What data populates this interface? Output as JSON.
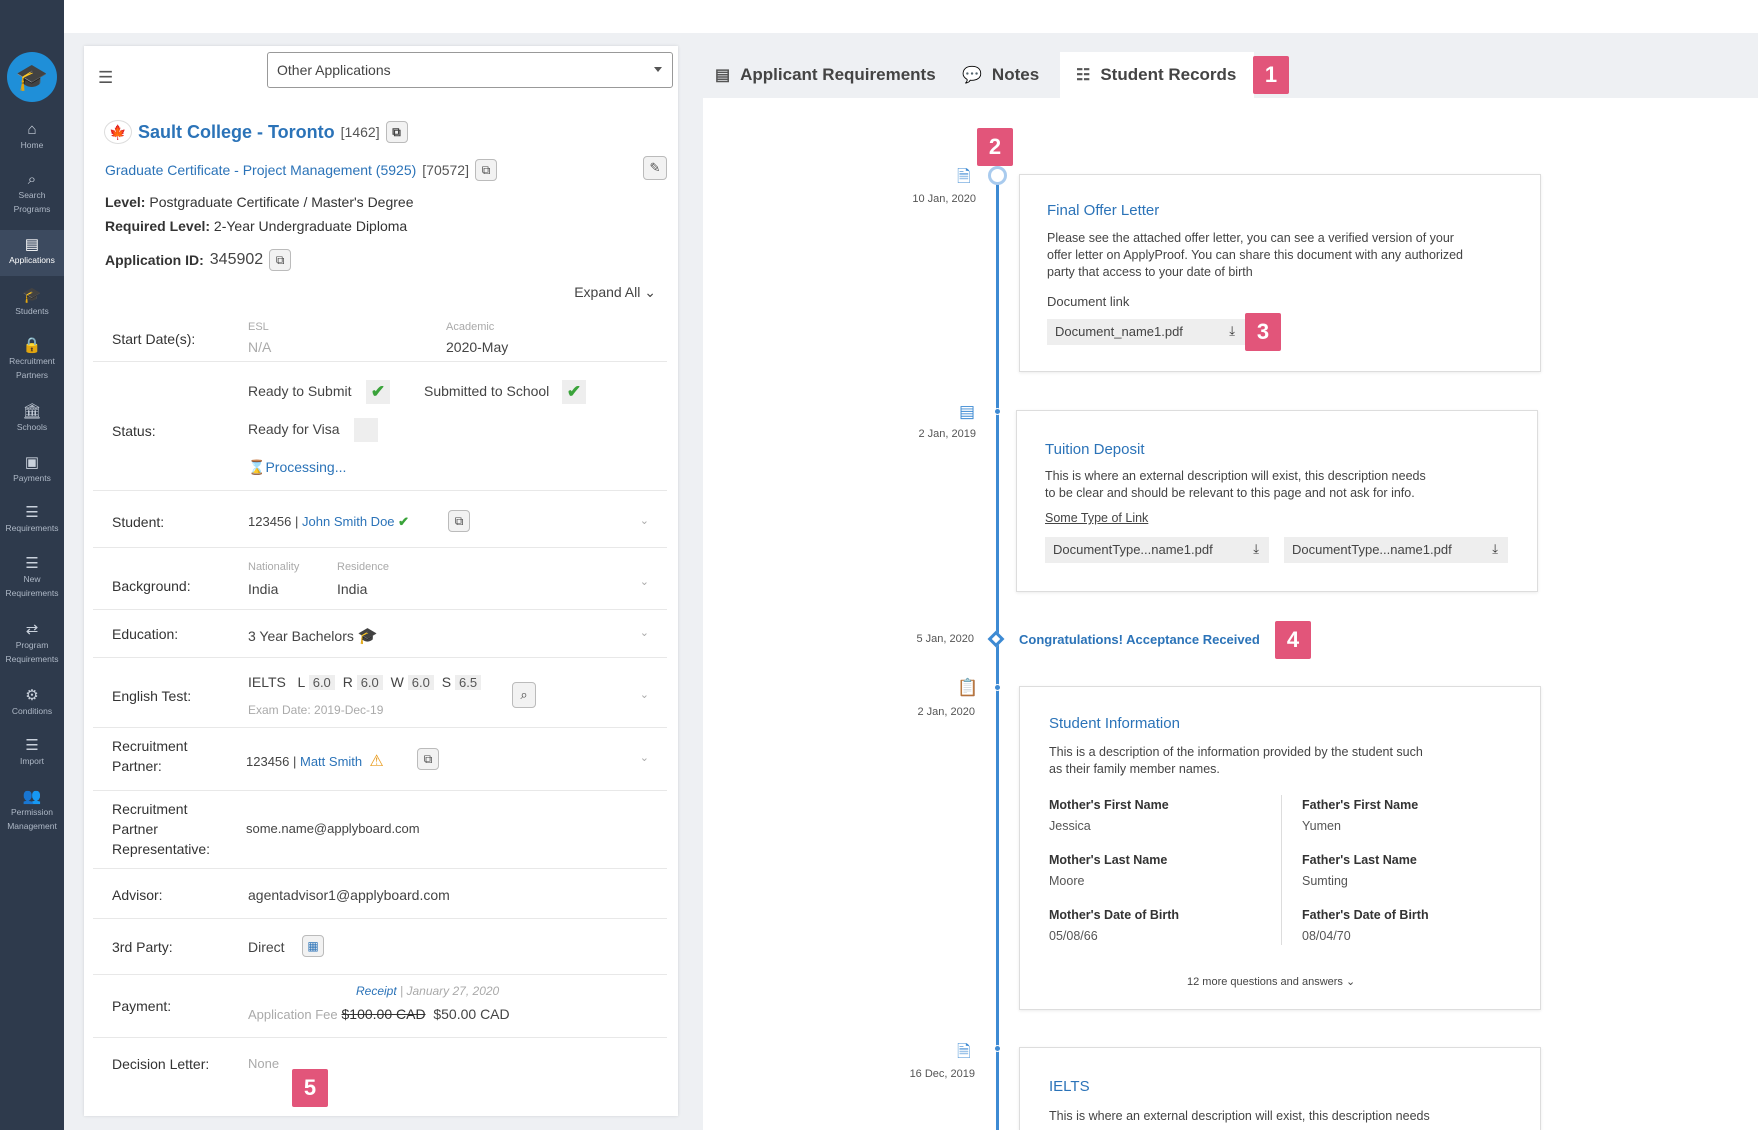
{
  "sidebar": {
    "items": [
      {
        "icon": "home-icon",
        "label": "Home"
      },
      {
        "icon": "search-icon",
        "label": "Search Programs"
      },
      {
        "icon": "applications-icon",
        "label": "Applications"
      },
      {
        "icon": "students-icon",
        "label": "Students"
      },
      {
        "icon": "lock-icon",
        "label": "Recruitment Partners"
      },
      {
        "icon": "schools-icon",
        "label": "Schools"
      },
      {
        "icon": "payments-icon",
        "label": "Payments"
      },
      {
        "icon": "list-icon",
        "label": "Requirements"
      },
      {
        "icon": "list-icon",
        "label": "New Requirements"
      },
      {
        "icon": "swap-icon",
        "label": "Program Requirements"
      },
      {
        "icon": "gears-icon",
        "label": "Conditions"
      },
      {
        "icon": "list-icon",
        "label": "Import"
      },
      {
        "icon": "users-icon",
        "label": "Permission Management"
      }
    ]
  },
  "application": {
    "select_value": "Other Applications",
    "school": "Sault College - Toronto",
    "school_id": "[1462]",
    "program": "Graduate Certificate - Project Management (5925)",
    "program_id": "[70572]",
    "level_label": "Level:",
    "level": "Postgraduate Certificate / Master's Degree",
    "required_level_label": "Required Level:",
    "required_level": "2-Year Undergraduate Diploma",
    "app_id_label": "Application ID:",
    "app_id": "345902",
    "expand_all": "Expand All"
  },
  "details": {
    "start_dates": {
      "label": "Start Date(s):",
      "esl_label": "ESL",
      "esl": "N/A",
      "academic_label": "Academic",
      "academic": "2020-May"
    },
    "status": {
      "label": "Status:",
      "ready_submit": "Ready to Submit",
      "submitted": "Submitted to School",
      "ready_visa": "Ready for Visa",
      "processing": "Processing..."
    },
    "student": {
      "label": "Student:",
      "id": "123456",
      "sep": "|",
      "name": "John Smith Doe"
    },
    "background": {
      "label": "Background:",
      "nationality_label": "Nationality",
      "nationality": "India",
      "residence_label": "Residence",
      "residence": "India"
    },
    "education": {
      "label": "Education:",
      "value": "3 Year Bachelors"
    },
    "english": {
      "label": "English Test:",
      "test": "IELTS",
      "l": "L",
      "l_val": "6.0",
      "r": "R",
      "r_val": "6.0",
      "w": "W",
      "w_val": "6.0",
      "s": "S",
      "s_val": "6.5",
      "exam_date": "Exam Date: 2019-Dec-19"
    },
    "partner": {
      "label_1": "Recruitment",
      "label_2": "Partner:",
      "id": "123456 |",
      "name": "Matt Smith"
    },
    "partner_rep": {
      "label_1": "Recruitment",
      "label_2": "Partner",
      "label_3": "Representative:",
      "value": "some.name@applyboard.com"
    },
    "advisor": {
      "label": "Advisor:",
      "value": "agentadvisor1@applyboard.com"
    },
    "third_party": {
      "label": "3rd Party:",
      "value": "Direct"
    },
    "payment": {
      "label": "Payment:",
      "receipt": "Receipt",
      "receipt_date": "| January 27, 2020",
      "fee_label": "Application Fee",
      "old_fee": "$100.00 CAD",
      "new_fee": "$50.00 CAD"
    },
    "decision": {
      "label": "Decision Letter:",
      "value": "None"
    }
  },
  "tabs": [
    {
      "label": "Applicant Requirements",
      "icon": "document-icon"
    },
    {
      "label": "Notes",
      "icon": "chat-icon"
    },
    {
      "label": "Student Records",
      "icon": "records-icon"
    }
  ],
  "badges": [
    "1",
    "2",
    "3",
    "4",
    "5"
  ],
  "timeline": {
    "offer": {
      "date": "10 Jan, 2020",
      "title": "Final Offer Letter",
      "desc_1": "Please see the attached offer letter, you can see a verified version of your",
      "desc_2": "offer letter on ApplyProof. You can share this document with any authorized",
      "desc_3": "party that access to your date of birth",
      "link": "Document link",
      "file": "Document_name1.pdf"
    },
    "deposit": {
      "date": "2 Jan, 2019",
      "title": "Tuition Deposit",
      "desc_1": "This is where an external description will exist, this description needs",
      "desc_2": "to be clear and should be relevant to this page and not ask for info.",
      "link": "Some Type of Link",
      "file_1": "DocumentType...name1.pdf",
      "file_2": "DocumentType...name1.pdf"
    },
    "acceptance": {
      "date": "5 Jan, 2020",
      "text": "Congratulations! Acceptance Received"
    },
    "student_info": {
      "date": "2 Jan, 2020",
      "title": "Student Information",
      "desc_1": "This is a description of the information provided by the student such",
      "desc_2": "as their family member names.",
      "mother_first_label": "Mother's First Name",
      "mother_first": "Jessica",
      "father_first_label": "Father's First Name",
      "father_first": "Yumen",
      "mother_last_label": "Mother's Last Name",
      "mother_last": "Moore",
      "father_last_label": "Father's Last Name",
      "father_last": "Sumting",
      "mother_dob_label": "Mother's Date of Birth",
      "mother_dob": "05/08/66",
      "father_dob_label": "Father's Date of Birth",
      "father_dob": "08/04/70",
      "more": "12 more questions and answers"
    },
    "ielts": {
      "date": "16 Dec, 2019",
      "title": "IELTS",
      "desc_1": "This is where an external description will exist, this description needs"
    }
  },
  "colors": {
    "sidebar": "#2e3a4c",
    "accent": "#2b73b8",
    "timeline": "#3d8ad3",
    "badge": "#e2557a",
    "check": "#3aa33a"
  }
}
